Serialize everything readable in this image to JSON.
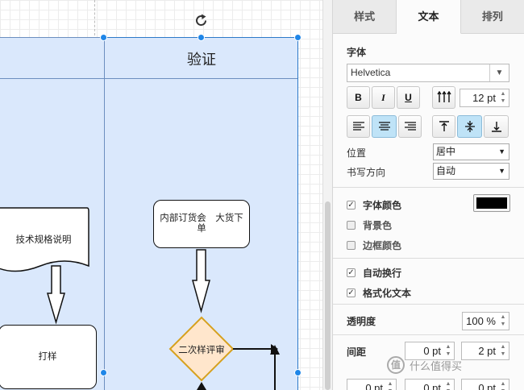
{
  "canvas": {
    "lane_title": "验证",
    "nodes": {
      "doc_label": "技术规格说明",
      "order_label": "内部订货会　大货下单",
      "sample_label": "打样",
      "diamond_label": "二次样评审"
    },
    "colors": {
      "pool_fill": "#dae8fc",
      "pool_stroke": "#6c8ebf",
      "diamond_fill": "#ffe6cc",
      "diamond_stroke": "#d6a11f",
      "selection": "#1f86e8"
    }
  },
  "panel": {
    "tabs": [
      {
        "label": "样式",
        "active": false
      },
      {
        "label": "文本",
        "active": true
      },
      {
        "label": "排列",
        "active": false
      }
    ],
    "font_section": "字体",
    "font_family": "Helvetica",
    "bold": "B",
    "italic": "I",
    "underline": "U",
    "font_size": "12 pt",
    "position_label": "位置",
    "position_value": "居中",
    "writing_dir_label": "书写方向",
    "writing_dir_value": "自动",
    "font_color_label": "字体颜色",
    "font_color": "#000000",
    "bg_color_label": "背景色",
    "border_color_label": "边框颜色",
    "wrap_label": "自动换行",
    "formatted_label": "格式化文本",
    "opacity_label": "透明度",
    "opacity_value": "100 %",
    "spacing_label": "间距",
    "spacing_top": "0 pt",
    "spacing_global": "2 pt",
    "spacing_row2_a": "0 pt",
    "spacing_row2_b": "0 pt",
    "spacing_row2_c": "0 pt",
    "checked": {
      "font_color": true,
      "background": false,
      "border": false,
      "wrap": true,
      "formatted": true
    }
  },
  "watermark": {
    "logo": "值",
    "text": "什么值得买"
  }
}
